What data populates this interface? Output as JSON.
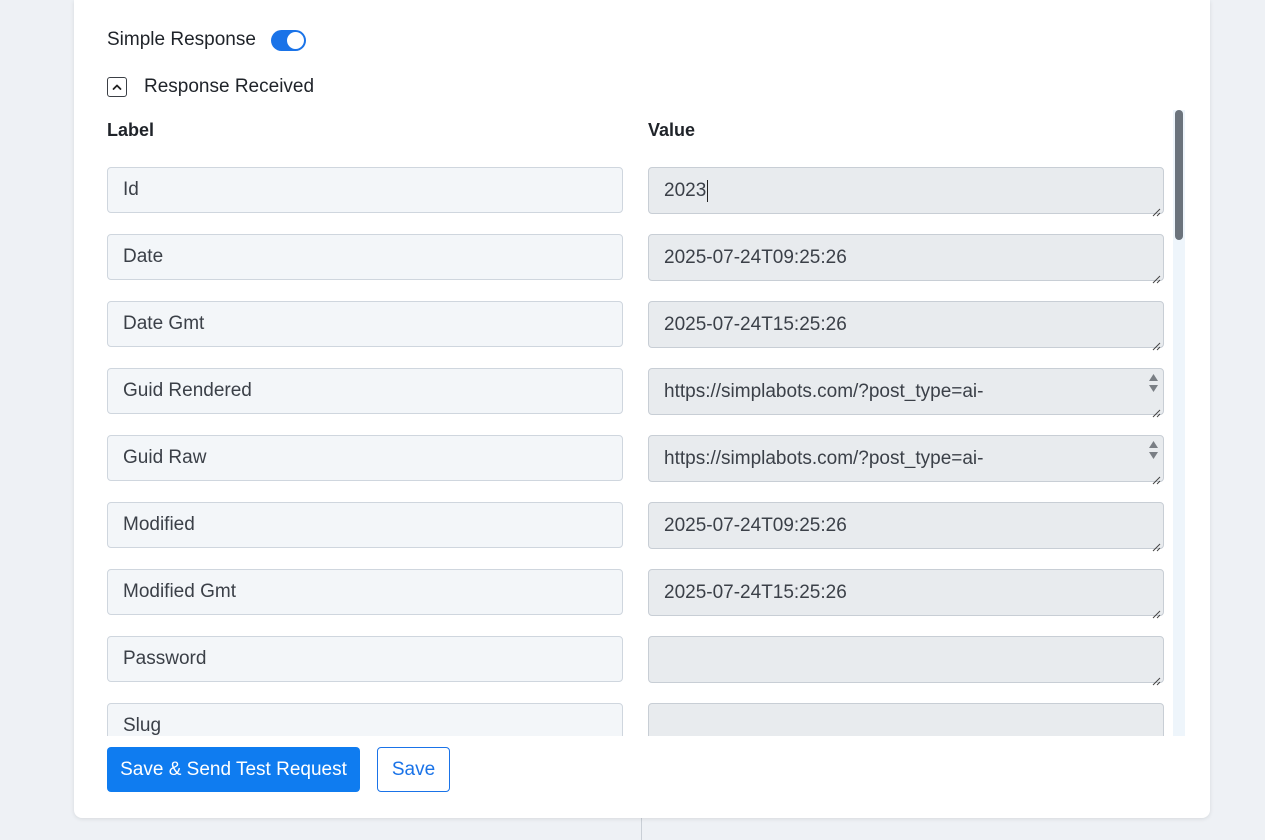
{
  "simple_response": {
    "label": "Simple Response",
    "enabled": true,
    "accent": "#1a73e8"
  },
  "response_received": {
    "label": "Response Received",
    "expanded": true
  },
  "columns": {
    "label": "Label",
    "value": "Value"
  },
  "rows": [
    {
      "label": "Id",
      "value": "2023",
      "spinner": false,
      "focused": true
    },
    {
      "label": "Date",
      "value": "2025-07-24T09:25:26",
      "spinner": false
    },
    {
      "label": "Date Gmt",
      "value": "2025-07-24T15:25:26",
      "spinner": false
    },
    {
      "label": "Guid Rendered",
      "value": "https://simplabots.com/?post_type=ai-",
      "spinner": true
    },
    {
      "label": "Guid Raw",
      "value": "https://simplabots.com/?post_type=ai-",
      "spinner": true
    },
    {
      "label": "Modified",
      "value": "2025-07-24T09:25:26",
      "spinner": false
    },
    {
      "label": "Modified Gmt",
      "value": "2025-07-24T15:25:26",
      "spinner": false
    },
    {
      "label": "Password",
      "value": "",
      "spinner": false
    },
    {
      "label": "Slug",
      "value": "",
      "spinner": false
    }
  ],
  "buttons": {
    "save_send": "Save & Send Test Request",
    "save": "Save"
  }
}
